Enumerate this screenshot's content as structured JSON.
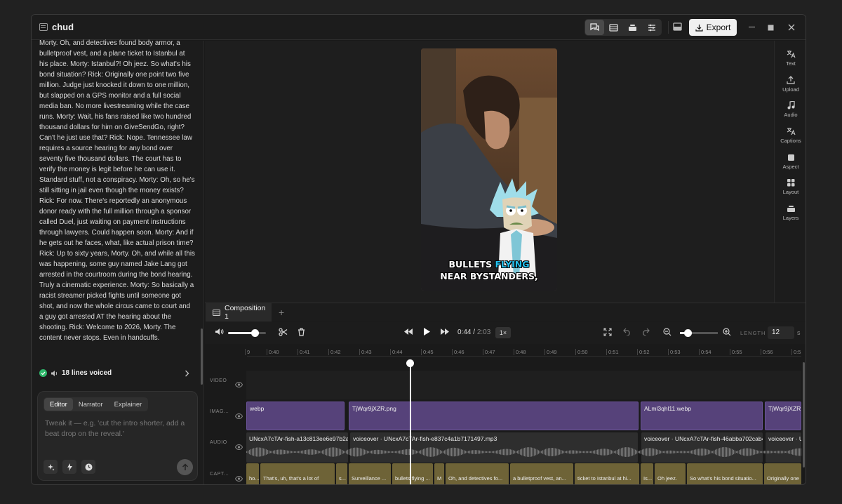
{
  "window": {
    "title": "chud",
    "export_label": "Export"
  },
  "transcript": {
    "text": "Morty. Oh, and detectives found body armor, a bulletproof vest, and a plane ticket to Istanbul at his place. Morty: Istanbul?! Oh jeez. So what's his bond situation? Rick: Originally one point two five million. Judge just knocked it down to one million, but slapped on a GPS monitor and a full social media ban. No more livestreaming while the case runs. Morty: Wait, his fans raised like two hundred thousand dollars for him on GiveSendGo, right? Can't he just use that? Rick: Nope. Tennessee law requires a source hearing for any bond over seventy five thousand dollars. The court has to verify the money is legit before he can use it. Standard stuff, not a conspiracy. Morty: Oh, so he's still sitting in jail even though the money exists? Rick: For now. There's reportedly an anonymous donor ready with the full million through a sponsor called Duel, just waiting on payment instructions through lawyers. Could happen soon. Morty: And if he gets out he faces, what, like actual prison time? Rick: Up to sixty years, Morty. Oh, and while all this was happening, some guy named Jake Lang got arrested in the courtroom during the bond hearing. Truly a cinematic experience. Morty: So basically a racist streamer picked fights until someone got shot, and now the whole circus came to court and a guy got arrested AT the hearing about the shooting. Rick: Welcome to 2026, Morty. The content never stops. Even in handcuffs.",
    "voiced_label": "18 lines voiced"
  },
  "composer": {
    "tabs": [
      "Editor",
      "Narrator",
      "Explainer"
    ],
    "active_tab": "Editor",
    "placeholder": "Tweak it — e.g. 'cut the intro shorter, add a beat drop on the reveal.'"
  },
  "preview": {
    "caption_line1_a": "BULLETS ",
    "caption_line1_b": "FLYING",
    "caption_line2": "NEAR BYSTANDERS,"
  },
  "right_tools": [
    {
      "label": "Text",
      "icon": "text-translate-icon"
    },
    {
      "label": "Upload",
      "icon": "upload-icon"
    },
    {
      "label": "Audio",
      "icon": "music-note-icon"
    },
    {
      "label": "Captions",
      "icon": "captions-icon"
    },
    {
      "label": "Aspect",
      "icon": "aspect-square-icon"
    },
    {
      "label": "Layout",
      "icon": "layout-grid-icon"
    },
    {
      "label": "Layers",
      "icon": "layers-icon"
    }
  ],
  "timeline_tabs": {
    "composition": "Composition 1",
    "add": "+"
  },
  "controls": {
    "current_time": "0:44",
    "total_time": "2:03",
    "rate": "1×",
    "length_label": "LENGTH",
    "length_value": "12",
    "length_unit": "s",
    "volume_level": 0.7,
    "zoom_level": 0.2
  },
  "ruler_ticks": [
    "9",
    "0:40",
    "0:41",
    "0:42",
    "0:43",
    "0:44",
    "0:45",
    "0:46",
    "0:47",
    "0:48",
    "0:49",
    "0:50",
    "0:51",
    "0:52",
    "0:53",
    "0:54",
    "0:55",
    "0:56",
    "0:5"
  ],
  "tracks": {
    "video": "VIDEO",
    "image": "IMAG...",
    "audio": "AUDIO",
    "caption": "CAPT..."
  },
  "image_clips": [
    "webp",
    "TjWqr9jXZR.png",
    "ALml3qhl11.webp",
    "TjWqr9jXZR.p"
  ],
  "audio_clips": [
    "UNcxA7cTAr-fish-a13c813ee6e97b2a.m",
    "voiceover · UNcxA7cTAr-fish-e837c4a1b7171497.mp3",
    "voiceover · UNcxA7cTAr-fish-46abba702cab4",
    "voiceover · U"
  ],
  "caption_clips": [
    "ho...",
    "That's, uh, that's a lot of",
    "s...",
    "Surveillance ...",
    "bullets flying ...",
    "M",
    "Oh, and detectives fo...",
    "a bulletproof vest, an...",
    "ticket to Istanbul at hi...",
    "Is...",
    "Oh jeez.",
    "So what's his bond situatio...",
    "Originally one"
  ],
  "colors": {
    "image_clip": "#56427a",
    "caption_clip": "#6e6337",
    "accent_caption": "#23c3f2",
    "voiced_check": "#2fb86b"
  }
}
